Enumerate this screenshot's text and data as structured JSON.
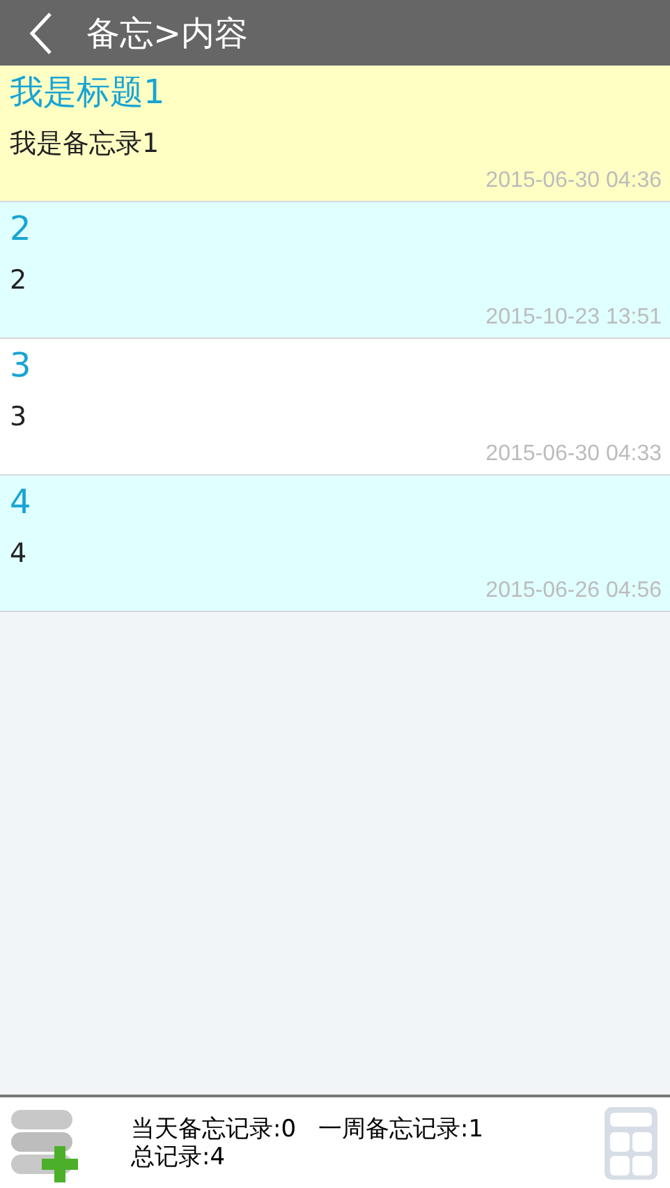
{
  "header": {
    "title": "备忘>内容"
  },
  "notes": [
    {
      "title": "我是标题1",
      "body": "我是备忘录1",
      "time": "2015-06-30 04:36",
      "color": "#ffffc4"
    },
    {
      "title": "2",
      "body": "2",
      "time": "2015-10-23 13:51",
      "color": "#e0ffff"
    },
    {
      "title": "3",
      "body": "3",
      "time": "2015-06-30 04:33",
      "color": "#ffffff"
    },
    {
      "title": "4",
      "body": "4",
      "time": "2015-06-26 04:56",
      "color": "#e0ffff"
    }
  ],
  "footer": {
    "today": "当天备忘记录:0",
    "week": "一周备忘记录:1",
    "total": "总记录:4"
  }
}
